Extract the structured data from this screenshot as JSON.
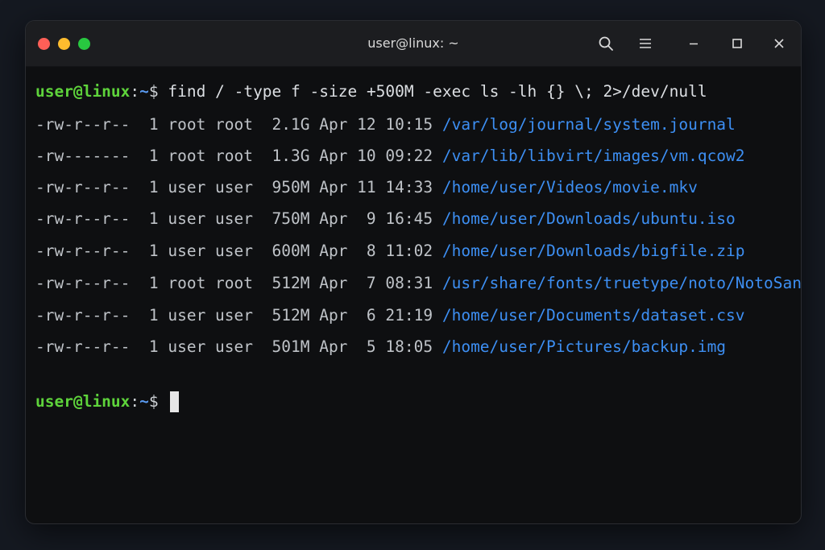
{
  "window": {
    "title": "user@linux: ~"
  },
  "titlebar_icons": [
    "search-icon",
    "menu-icon",
    "minimize-icon",
    "maximize-icon",
    "close-icon"
  ],
  "colors": {
    "prompt_user": "#5ed33b",
    "prompt_path": "#5a9bf2",
    "file_path": "#3d8ff3",
    "close": "#fe5f57",
    "minimize": "#febc2e",
    "zoom": "#28c840"
  },
  "prompt": {
    "user_host": "user@linux",
    "colon": ":",
    "path": "~",
    "dollar": "$"
  },
  "command": "find / -type f -size +500M -exec ls -lh {} \\; 2>/dev/null",
  "output": [
    {
      "meta": "-rw-r--r--  1 root root  2.1G Apr 12 10:15",
      "path": "/var/log/journal/system.journal"
    },
    {
      "meta": "-rw-------  1 root root  1.3G Apr 10 09:22",
      "path": "/var/lib/libvirt/images/vm.qcow2"
    },
    {
      "meta": "-rw-r--r--  1 user user  950M Apr 11 14:33",
      "path": "/home/user/Videos/movie.mkv"
    },
    {
      "meta": "-rw-r--r--  1 user user  750M Apr  9 16:45",
      "path": "/home/user/Downloads/ubuntu.iso"
    },
    {
      "meta": "-rw-r--r--  1 user user  600M Apr  8 11:02",
      "path": "/home/user/Downloads/bigfile.zip"
    },
    {
      "meta": "-rw-r--r--  1 root root  512M Apr  7 08:31",
      "path": "/usr/share/fonts/truetype/noto/NotoSansCJK.ttc"
    },
    {
      "meta": "-rw-r--r--  1 user user  512M Apr  6 21:19",
      "path": "/home/user/Documents/dataset.csv"
    },
    {
      "meta": "-rw-r--r--  1 user user  501M Apr  5 18:05",
      "path": "/home/user/Pictures/backup.img"
    }
  ]
}
